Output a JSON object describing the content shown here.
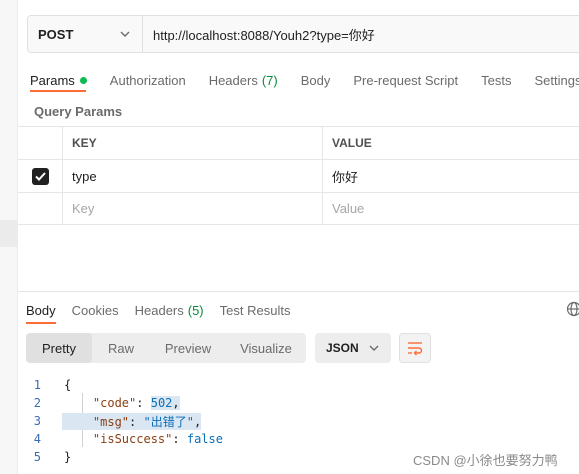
{
  "request": {
    "method": "POST",
    "url": "http://localhost:8088/Youh2?type=你好"
  },
  "request_tabs": [
    {
      "label": "Params",
      "active": true,
      "dot": true
    },
    {
      "label": "Authorization"
    },
    {
      "label": "Headers",
      "count": "(7)"
    },
    {
      "label": "Body"
    },
    {
      "label": "Pre-request Script"
    },
    {
      "label": "Tests"
    },
    {
      "label": "Settings"
    }
  ],
  "query_params": {
    "section_label": "Query Params",
    "headers": {
      "key": "KEY",
      "value": "VALUE"
    },
    "rows": [
      {
        "checked": true,
        "key": "type",
        "value": "你好"
      }
    ],
    "placeholder": {
      "key": "Key",
      "value": "Value"
    }
  },
  "response_tabs": [
    {
      "label": "Body",
      "active": true
    },
    {
      "label": "Cookies"
    },
    {
      "label": "Headers",
      "count": "(5)"
    },
    {
      "label": "Test Results"
    }
  ],
  "view_modes": [
    {
      "label": "Pretty",
      "active": true
    },
    {
      "label": "Raw"
    },
    {
      "label": "Preview"
    },
    {
      "label": "Visualize"
    }
  ],
  "format": "JSON",
  "code_lines": [
    {
      "n": "1",
      "text": "{"
    },
    {
      "n": "2",
      "key": "\"code\"",
      "value": "502"
    },
    {
      "n": "3",
      "key": "\"msg\"",
      "value": "\"出错了\""
    },
    {
      "n": "4",
      "key": "\"isSuccess\"",
      "value": "false"
    },
    {
      "n": "5",
      "text": "}"
    }
  ],
  "watermark": "CSDN @小徐也要努力鸭",
  "colors": {
    "accent": "#ff6c37",
    "success": "#0cbb52"
  }
}
